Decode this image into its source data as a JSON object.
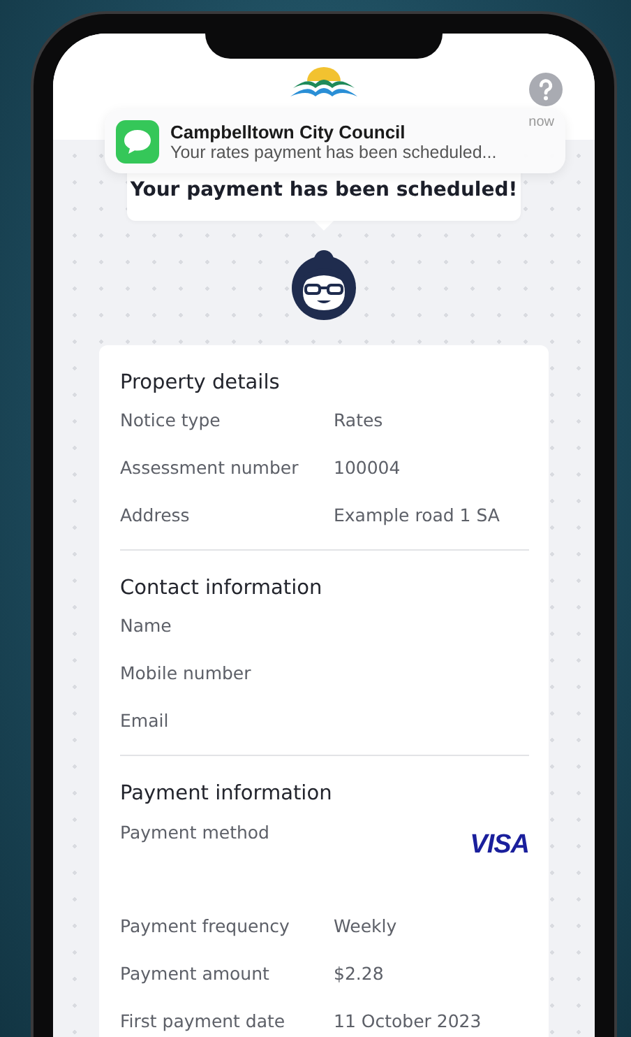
{
  "notification": {
    "app": "Campbelltown City Council",
    "message": "Your rates payment has been scheduled...",
    "time": "now"
  },
  "banner": "Your payment has been scheduled!",
  "sections": [
    {
      "title": "Property details",
      "rows": [
        {
          "kind": "text",
          "label": "Notice type",
          "value": "Rates"
        },
        {
          "kind": "text",
          "label": "Assessment number",
          "value": "100004"
        },
        {
          "kind": "text",
          "label": "Address",
          "value": "Example road 1 SA"
        }
      ]
    },
    {
      "title": "Contact information",
      "rows": [
        {
          "kind": "text",
          "label": "Name"
        },
        {
          "kind": "text",
          "label": "Mobile number"
        },
        {
          "kind": "text",
          "label": "Email"
        }
      ]
    },
    {
      "title": "Payment information",
      "rows": [
        {
          "kind": "card",
          "label": "Payment method",
          "value": "VISA"
        },
        {
          "kind": "text",
          "label": "Payment frequency",
          "value": "Weekly"
        },
        {
          "kind": "text",
          "label": "Payment amount",
          "value": "$2.28"
        },
        {
          "kind": "text",
          "label": "First payment date",
          "value": "11 October 2023"
        }
      ]
    }
  ]
}
